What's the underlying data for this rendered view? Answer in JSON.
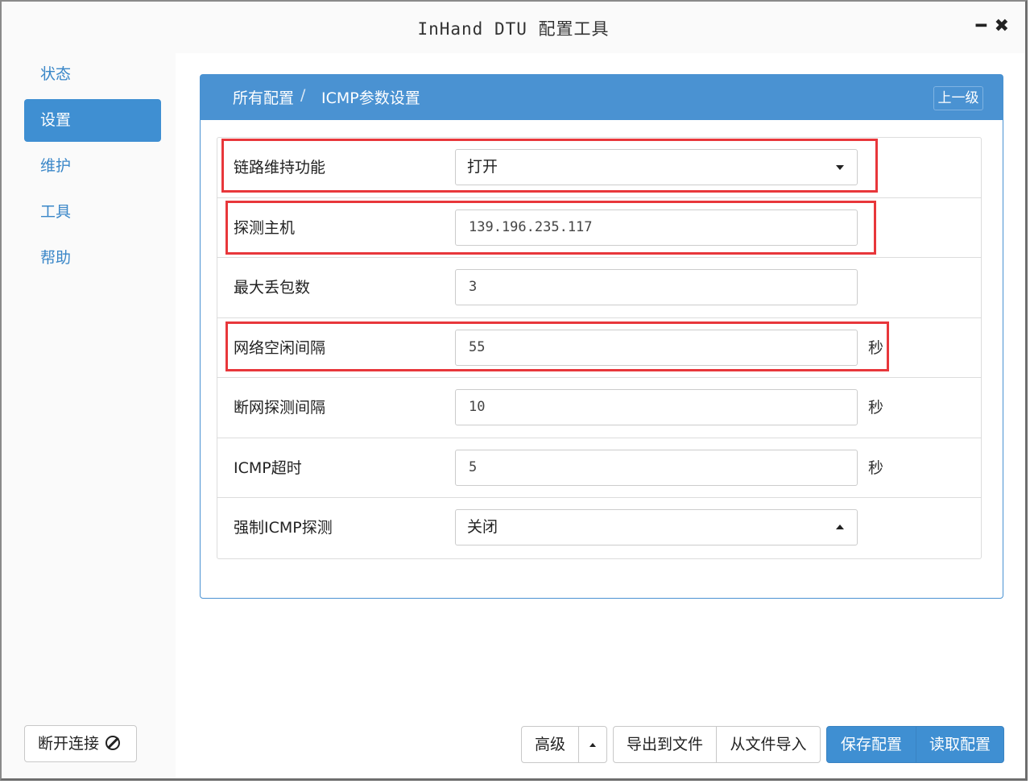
{
  "window": {
    "title": "InHand DTU 配置工具"
  },
  "sidebar": {
    "items": [
      {
        "label": "状态",
        "active": false
      },
      {
        "label": "设置",
        "active": true
      },
      {
        "label": "维护",
        "active": false
      },
      {
        "label": "工具",
        "active": false
      },
      {
        "label": "帮助",
        "active": false
      }
    ],
    "disconnect_label": "断开连接"
  },
  "panel": {
    "breadcrumb": [
      "所有配置",
      "ICMP参数设置"
    ],
    "breadcrumb_sep": "/",
    "back_label": "上一级"
  },
  "form": {
    "rows": [
      {
        "label": "链路维持功能",
        "type": "select",
        "value": "打开",
        "highlighted": true
      },
      {
        "label": "探测主机",
        "type": "text",
        "value": "139.196.235.117",
        "highlighted": true
      },
      {
        "label": "最大丢包数",
        "type": "text",
        "value": "3",
        "highlighted": false
      },
      {
        "label": "网络空闲间隔",
        "type": "text",
        "value": "55",
        "unit": "秒",
        "highlighted": true
      },
      {
        "label": "断网探测间隔",
        "type": "text",
        "value": "10",
        "unit": "秒",
        "highlighted": false
      },
      {
        "label": "ICMP超时",
        "type": "text",
        "value": "5",
        "unit": "秒",
        "highlighted": false
      },
      {
        "label": "强制ICMP探测",
        "type": "select",
        "value": "关闭",
        "highlighted": false
      }
    ]
  },
  "footer": {
    "advanced_label": "高级",
    "export_label": "导出到文件",
    "import_label": "从文件导入",
    "save_label": "保存配置",
    "read_label": "读取配置"
  },
  "colors": {
    "accent": "#3f8fd2",
    "highlight": "#e8373b"
  }
}
